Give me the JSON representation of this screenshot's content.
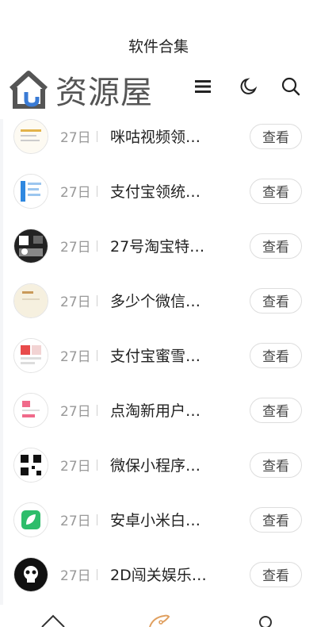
{
  "header": {
    "title": "软件合集",
    "logo_text": "资源屋",
    "icons": [
      "menu-icon",
      "moon-icon",
      "search-icon"
    ]
  },
  "list": {
    "button_label": "查看",
    "items": [
      {
        "date": "27日",
        "title": "咪咕视频领…",
        "thumb": "light"
      },
      {
        "date": "27日",
        "title": "支付宝领统…",
        "thumb": "blue"
      },
      {
        "date": "27日",
        "title": "27号淘宝特…",
        "thumb": "dark"
      },
      {
        "date": "27日",
        "title": "多少个微信…",
        "thumb": "cream"
      },
      {
        "date": "27日",
        "title": "支付宝蜜雪…",
        "thumb": "red"
      },
      {
        "date": "27日",
        "title": "点淘新用户…",
        "thumb": "pink"
      },
      {
        "date": "27日",
        "title": "微保小程序…",
        "thumb": "qr"
      },
      {
        "date": "27日",
        "title": "安卓小米白…",
        "thumb": "green"
      },
      {
        "date": "27日",
        "title": "2D闯关娱乐…",
        "thumb": "black"
      }
    ]
  },
  "bottom_nav": {
    "icons": [
      "home-icon",
      "rocket-icon",
      "user-icon"
    ],
    "active_color": "#e0a060"
  }
}
